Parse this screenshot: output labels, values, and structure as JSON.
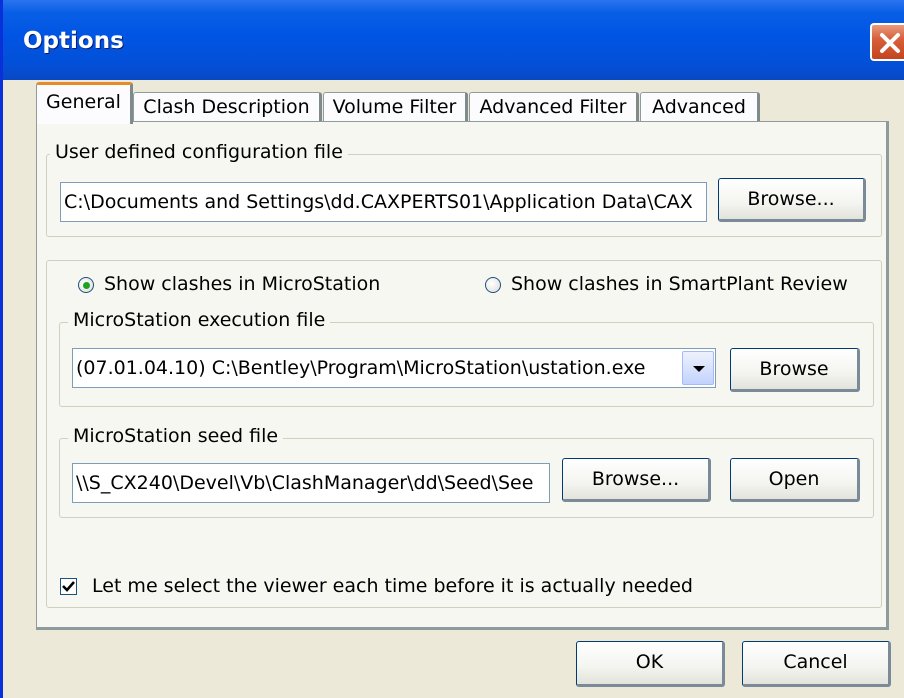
{
  "window": {
    "title": "Options"
  },
  "tabs": [
    {
      "label": "General",
      "active": true
    },
    {
      "label": "Clash Description",
      "active": false
    },
    {
      "label": "Volume Filter",
      "active": false
    },
    {
      "label": "Advanced Filter",
      "active": false
    },
    {
      "label": "Advanced",
      "active": false
    }
  ],
  "config_group": {
    "legend": "User defined configuration file",
    "path_value": "C:\\Documents and Settings\\dd.CAXPERTS01\\Application Data\\CAX",
    "browse_label": "Browse..."
  },
  "viewer": {
    "radio_microstation": {
      "label": "Show clashes in MicroStation",
      "selected": true
    },
    "radio_smartplant": {
      "label": "Show clashes in SmartPlant Review",
      "selected": false
    },
    "exec_group": {
      "legend": "MicroStation execution file",
      "selected_value": "(07.01.04.10) C:\\Bentley\\Program\\MicroStation\\ustation.exe",
      "browse_label": "Browse"
    },
    "seed_group": {
      "legend": "MicroStation seed file",
      "path_value": "\\\\S_CX240\\Devel\\Vb\\ClashManager\\dd\\Seed\\See",
      "browse_label": "Browse...",
      "open_label": "Open"
    },
    "select_viewer_checkbox": {
      "label": "Let me select the viewer each time before it is actually needed",
      "checked": true
    }
  },
  "footer": {
    "ok_label": "OK",
    "cancel_label": "Cancel"
  }
}
